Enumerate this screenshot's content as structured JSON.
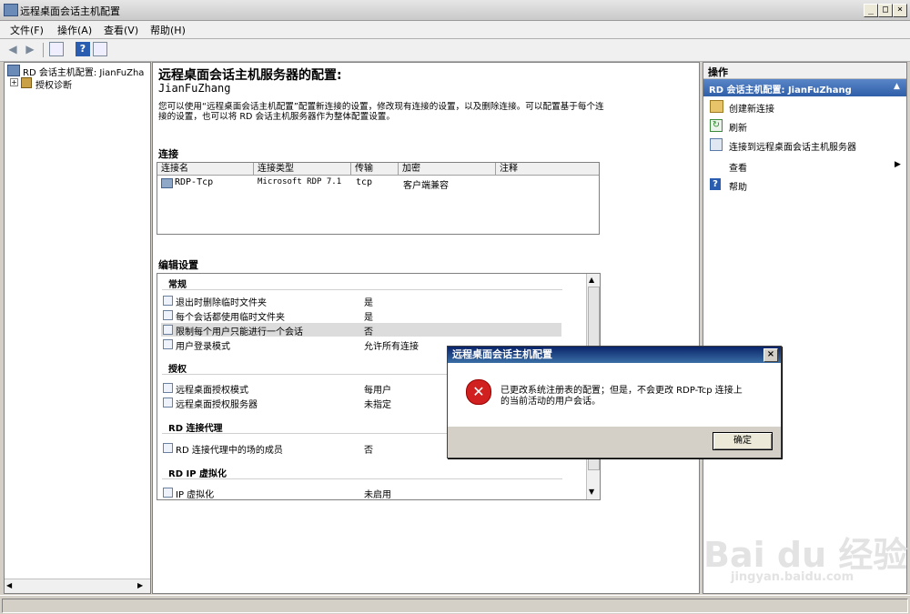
{
  "window": {
    "title": "远程桌面会话主机配置"
  },
  "menu": {
    "file": "文件(F)",
    "action": "操作(A)",
    "view": "查看(V)",
    "help": "帮助(H)"
  },
  "tree": {
    "root": "RD 会话主机配置: JianFuZha",
    "child": "授权诊断"
  },
  "main": {
    "title": "远程桌面会话主机服务器的配置:",
    "server": "JianFuZhang",
    "desc_line1": "您可以使用“远程桌面会话主机配置”配置新连接的设置，修改现有连接的设置，以及删除连接。可以配置基于每个连",
    "desc_line2": "接的设置，也可以将 RD 会话主机服务器作为整体配置设置。",
    "connections_label": "连接",
    "columns": [
      "连接名",
      "连接类型",
      "传输",
      "加密",
      "注释"
    ],
    "row": {
      "name": "RDP-Tcp",
      "type": "Microsoft RDP 7.1",
      "transport": "tcp",
      "encryption": "客户端兼容",
      "comment": ""
    },
    "edit_settings_label": "编辑设置",
    "sections": {
      "general": "常规",
      "licensing": "授权",
      "broker": "RD 连接代理",
      "ipv": "RD IP 虚拟化"
    },
    "settings": [
      {
        "label": "退出时删除临时文件夹",
        "value": "是"
      },
      {
        "label": "每个会话都使用临时文件夹",
        "value": "是"
      },
      {
        "label": "限制每个用户只能进行一个会话",
        "value": "否"
      },
      {
        "label": "用户登录模式",
        "value": "允许所有连接"
      },
      {
        "label": "远程桌面授权模式",
        "value": "每用户"
      },
      {
        "label": "远程桌面授权服务器",
        "value": "未指定"
      },
      {
        "label": "RD 连接代理中的场的成员",
        "value": "否"
      },
      {
        "label": "IP 虚拟化",
        "value": "未启用"
      }
    ]
  },
  "actions": {
    "header": "操作",
    "subheader": "RD 会话主机配置: JianFuZhang",
    "items": [
      "创建新连接",
      "刷新",
      "连接到远程桌面会话主机服务器",
      "查看",
      "帮助"
    ]
  },
  "dialog": {
    "title": "远程桌面会话主机配置",
    "message_line1": "已更改系统注册表的配置；但是，不会更改 RDP-Tcp 连接上",
    "message_line2": "的当前活动的用户会话。",
    "ok": "确定"
  },
  "watermark": {
    "brand": "Bai du 经验",
    "url": "jingyan.baidu.com"
  }
}
